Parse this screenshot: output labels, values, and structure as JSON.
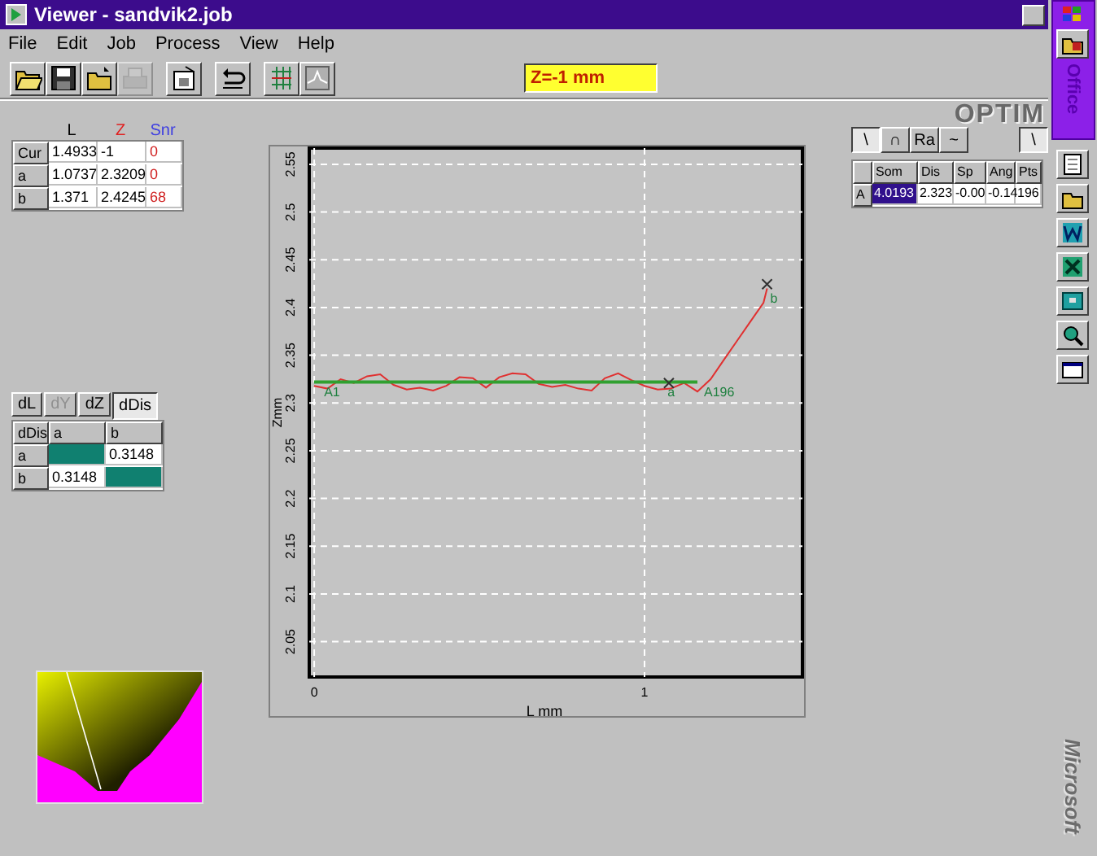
{
  "window": {
    "title": "Viewer - sandvik2.job"
  },
  "menu": [
    "File",
    "Edit",
    "Job",
    "Process",
    "View",
    "Help"
  ],
  "toolbar": {
    "buttons": [
      {
        "kind": "open",
        "disabled": false
      },
      {
        "kind": "save",
        "disabled": false
      },
      {
        "kind": "folder",
        "disabled": false
      },
      {
        "kind": "print",
        "disabled": true
      },
      {
        "kind": "properties",
        "disabled": false
      },
      {
        "kind": "undo",
        "disabled": false
      },
      {
        "kind": "grid",
        "disabled": false
      },
      {
        "kind": "profile",
        "disabled": false
      }
    ],
    "z_readout": "Z=-1 mm",
    "logo": "OPTIM"
  },
  "cursor_table": {
    "columns": [
      {
        "label": "L",
        "color": "#000000"
      },
      {
        "label": "Z",
        "color": "#e02020"
      },
      {
        "label": "Snr",
        "color": "#4040e0"
      }
    ],
    "rows": [
      {
        "label": "Cur",
        "values": [
          "1.4933",
          "-1",
          "0"
        ]
      },
      {
        "label": "a",
        "values": [
          "1.0737",
          "2.3209",
          "0"
        ]
      },
      {
        "label": "b",
        "values": [
          "1.371",
          "2.4245",
          "68"
        ]
      }
    ]
  },
  "delta_tabs": [
    {
      "label": "dL",
      "selected": false,
      "disabled": false
    },
    {
      "label": "dY",
      "selected": false,
      "disabled": true
    },
    {
      "label": "dZ",
      "selected": false,
      "disabled": false
    },
    {
      "label": "dDis",
      "selected": true,
      "disabled": false
    }
  ],
  "delta_table": {
    "corner": "dDis",
    "columns": [
      "a",
      "b"
    ],
    "rows": [
      {
        "label": "a",
        "cells": [
          {
            "diagonal": true
          },
          {
            "diagonal": false,
            "text": "0.3148"
          }
        ]
      },
      {
        "label": "b",
        "cells": [
          {
            "diagonal": false,
            "text": "0.3148"
          },
          {
            "diagonal": true
          }
        ]
      }
    ]
  },
  "profile_chart": {
    "chart_data": {
      "type": "line",
      "xlabel": "L mm",
      "ylabel": "Zmm",
      "xlim": [
        -0.015,
        1.478
      ],
      "ylim": [
        2.013,
        2.567
      ],
      "xticks": [
        0,
        1
      ],
      "yticks": [
        {
          "value": 2.05,
          "label": "2.05"
        },
        {
          "value": 2.1,
          "label": "2.1"
        },
        {
          "value": 2.15,
          "label": "2.15"
        },
        {
          "value": 2.2,
          "label": "2.2"
        },
        {
          "value": 2.25,
          "label": "2.25"
        },
        {
          "value": 2.3,
          "label": "2.3"
        },
        {
          "value": 2.35,
          "label": "2.35"
        },
        {
          "value": 2.4,
          "label": "2.4"
        },
        {
          "value": 2.45,
          "label": "2.45"
        },
        {
          "value": 2.5,
          "label": "2.5"
        },
        {
          "value": 2.55,
          "label": "2.55"
        }
      ],
      "x": [
        0,
        0.04,
        0.08,
        0.12,
        0.16,
        0.2,
        0.24,
        0.28,
        0.32,
        0.36,
        0.4,
        0.44,
        0.48,
        0.52,
        0.56,
        0.6,
        0.64,
        0.68,
        0.72,
        0.76,
        0.8,
        0.84,
        0.88,
        0.92,
        0.96,
        1.0,
        1.04,
        1.08,
        1.12,
        1.16,
        1.2,
        1.24,
        1.28,
        1.32,
        1.36,
        1.371
      ],
      "series": [
        {
          "color": "#e03030",
          "values": [
            2.318,
            2.315,
            2.325,
            2.321,
            2.328,
            2.33,
            2.319,
            2.314,
            2.316,
            2.313,
            2.318,
            2.327,
            2.326,
            2.316,
            2.327,
            2.331,
            2.33,
            2.32,
            2.317,
            2.319,
            2.315,
            2.313,
            2.326,
            2.331,
            2.324,
            2.318,
            2.314,
            2.315,
            2.321,
            2.312,
            2.325,
            2.345,
            2.365,
            2.385,
            2.405,
            2.42
          ]
        },
        {
          "color": "#30a030",
          "values": [
            2.322,
            2.322,
            2.322,
            2.322,
            2.322,
            2.322,
            2.322,
            2.322,
            2.322,
            2.322,
            2.322,
            2.322,
            2.322,
            2.322,
            2.322,
            2.322,
            2.322,
            2.322,
            2.322,
            2.322,
            2.322,
            2.322,
            2.322,
            2.322,
            2.322,
            2.322,
            2.322,
            2.322,
            2.322,
            2.322,
            null,
            null,
            null,
            null,
            null,
            null
          ]
        }
      ],
      "grid": true,
      "annotations": [
        {
          "text": "A1",
          "x": 0.02,
          "y": 2.322
        },
        {
          "text": "a",
          "x": 1.06,
          "y": 2.322
        },
        {
          "text": "A196",
          "x": 1.17,
          "y": 2.322
        },
        {
          "text": "b",
          "x": 1.371,
          "y": 2.42
        }
      ]
    }
  },
  "profile_tools": [
    {
      "label": "\\",
      "selected": true
    },
    {
      "label": "∩",
      "selected": false
    },
    {
      "label": "Ra",
      "selected": false
    },
    {
      "label": "~",
      "selected": false
    }
  ],
  "line_tool": {
    "label": "\\",
    "selected": true
  },
  "measure_table": {
    "columns": [
      "Som",
      "Dis",
      "Sp",
      "Ang",
      "Pts"
    ],
    "rows": [
      {
        "label": "A",
        "cells": [
          {
            "text": "4.0193",
            "selected": true
          },
          {
            "text": "2.323",
            "selected": false
          },
          {
            "text": "-0.00",
            "selected": false
          },
          {
            "text": "-0.14",
            "selected": false
          },
          {
            "text": "196",
            "selected": false
          }
        ]
      }
    ]
  },
  "office_bar": {
    "title": "Office",
    "brand": "Microsoft"
  }
}
